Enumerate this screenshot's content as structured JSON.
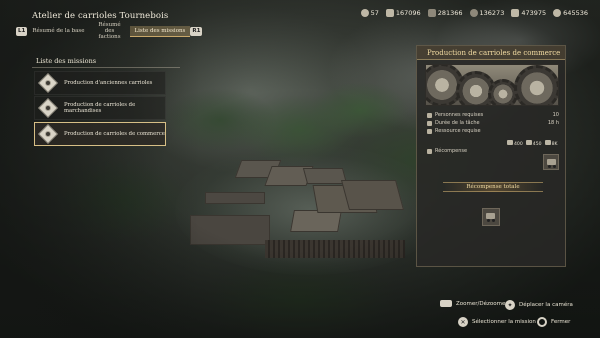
{
  "header": {
    "title": "Atelier de carrioles Tournebois",
    "tabs": {
      "left_key": "L1",
      "right_key": "R1",
      "items": [
        {
          "label": "Résumé de la base"
        },
        {
          "label": "Résumé des factions"
        },
        {
          "label": "Liste des missions"
        }
      ]
    }
  },
  "resources": [
    {
      "icon": "helmet-icon",
      "value": "57"
    },
    {
      "icon": "cart-icon",
      "value": "167096"
    },
    {
      "icon": "wood-icon",
      "value": "281366"
    },
    {
      "icon": "stone-icon",
      "value": "136273"
    },
    {
      "icon": "ingot-icon",
      "value": "473975"
    },
    {
      "icon": "coin-icon",
      "value": "645536"
    }
  ],
  "mission_list": {
    "title": "Liste des missions",
    "items": [
      {
        "label": "Production d'anciennes carrioles",
        "selected": false
      },
      {
        "label": "Production de carrioles de marchandises",
        "selected": false
      },
      {
        "label": "Production de carrioles de commerce",
        "selected": true
      }
    ]
  },
  "details": {
    "title": "Production de carrioles de commerce",
    "stats": [
      {
        "icon": "person-icon",
        "label": "Personnes requises",
        "value": "10"
      },
      {
        "icon": "hourglass-icon",
        "label": "Durée de la tâche",
        "value": "18 h"
      },
      {
        "icon": "crate-icon",
        "label": "Ressource requise",
        "value": ""
      }
    ],
    "required_resources": [
      {
        "icon": "wood-icon",
        "value": "400"
      },
      {
        "icon": "stone-icon",
        "value": "450"
      },
      {
        "icon": "ingot-icon",
        "value": "8K"
      }
    ],
    "reward_label": "Récompense",
    "total_reward_label": "Récompense totale"
  },
  "footer": {
    "zoom": "Zoomer/Dézoomer",
    "move_camera": "Déplacer la caméra",
    "select_mission": "Sélectionner la mission",
    "close": "Fermer"
  }
}
